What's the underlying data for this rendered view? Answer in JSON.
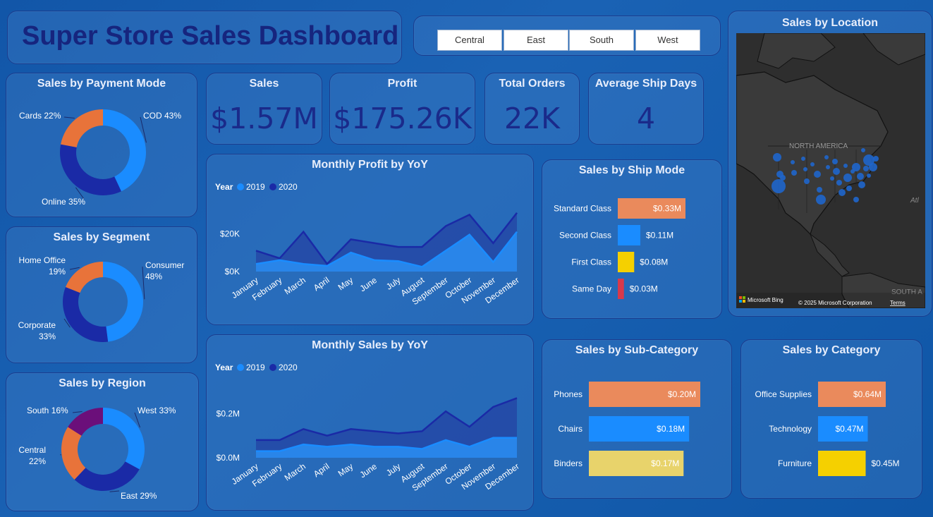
{
  "title": "Super Store Sales Dashboard",
  "slicer": {
    "options": [
      "Central",
      "East",
      "South",
      "West"
    ]
  },
  "kpis": {
    "sales": {
      "label": "Sales",
      "value": "$1.57M"
    },
    "profit": {
      "label": "Profit",
      "value": "$175.26K"
    },
    "orders": {
      "label": "Total Orders",
      "value": "22K"
    },
    "ship_days": {
      "label": "Average Ship Days",
      "value": "4"
    }
  },
  "map": {
    "title": "Sales by Location",
    "continent_label": "NORTH AMERICA",
    "south_label": "SOUTH A",
    "atl_label": "Atl",
    "bing_label": "Microsoft Bing",
    "copyright": "© 2025 Microsoft Corporation",
    "terms": "Terms"
  },
  "colors": {
    "orange": "#e8733a",
    "blue": "#1a8cff",
    "navy": "#1a2aa6",
    "purple": "#6b0f7a",
    "yellow": "#f5d000",
    "red": "#d8394b",
    "salmon": "#ea8a5c",
    "khaki": "#e8d36b",
    "series2019": "#1a8cff",
    "series2020": "#1a2aa6"
  },
  "chart_data": [
    {
      "id": "payment",
      "type": "pie",
      "title": "Sales by Payment Mode",
      "labels": [
        "COD",
        "Online",
        "Cards"
      ],
      "values": [
        43,
        35,
        22
      ],
      "label_texts": [
        "COD 43%",
        "Online 35%",
        "Cards 22%"
      ]
    },
    {
      "id": "segment",
      "type": "pie",
      "title": "Sales by Segment",
      "labels": [
        "Consumer",
        "Corporate",
        "Home Office"
      ],
      "values": [
        48,
        33,
        19
      ],
      "label_texts": [
        "Consumer\n48%",
        "Corporate\n33%",
        "Home Office\n19%"
      ]
    },
    {
      "id": "region",
      "type": "pie",
      "title": "Sales by Region",
      "labels": [
        "West",
        "East",
        "Central",
        "South"
      ],
      "values": [
        33,
        29,
        22,
        16
      ],
      "label_texts": [
        "West 33%",
        "East 29%",
        "Central\n22%",
        "South 16%"
      ]
    },
    {
      "id": "profit_yoy",
      "type": "area",
      "title": "Monthly Profit by YoY",
      "legend_title": "Year",
      "categories": [
        "January",
        "February",
        "March",
        "April",
        "May",
        "June",
        "July",
        "August",
        "September",
        "October",
        "November",
        "December"
      ],
      "series": [
        {
          "name": "2019",
          "values": [
            4000,
            6000,
            4000,
            3000,
            10000,
            6000,
            5500,
            2500,
            11000,
            19500,
            5000,
            21000
          ]
        },
        {
          "name": "2020",
          "values": [
            11000,
            7000,
            21000,
            4000,
            17000,
            15000,
            13000,
            13000,
            24000,
            30000,
            15000,
            31000
          ]
        }
      ],
      "ylim": [
        0,
        35000
      ],
      "yticks": [
        0,
        20000
      ],
      "ytick_labels": [
        "$0K",
        "$20K"
      ]
    },
    {
      "id": "sales_yoy",
      "type": "area",
      "title": "Monthly Sales by YoY",
      "legend_title": "Year",
      "categories": [
        "January",
        "February",
        "March",
        "April",
        "May",
        "June",
        "July",
        "August",
        "September",
        "October",
        "November",
        "December"
      ],
      "series": [
        {
          "name": "2019",
          "values": [
            0.03,
            0.03,
            0.06,
            0.05,
            0.06,
            0.05,
            0.05,
            0.04,
            0.08,
            0.05,
            0.09,
            0.09
          ]
        },
        {
          "name": "2020",
          "values": [
            0.08,
            0.08,
            0.13,
            0.1,
            0.13,
            0.12,
            0.11,
            0.12,
            0.21,
            0.14,
            0.23,
            0.27
          ]
        }
      ],
      "ylim": [
        0,
        0.3
      ],
      "yticks": [
        0,
        0.2
      ],
      "ytick_labels": [
        "$0.0M",
        "$0.2M"
      ]
    },
    {
      "id": "ship_mode",
      "type": "bar",
      "title": "Sales by Ship Mode",
      "categories": [
        "Standard Class",
        "Second Class",
        "First Class",
        "Same Day"
      ],
      "values": [
        0.33,
        0.11,
        0.08,
        0.03
      ],
      "value_labels": [
        "$0.33M",
        "$0.11M",
        "$0.08M",
        "$0.03M"
      ],
      "xlim": [
        0,
        0.33
      ]
    },
    {
      "id": "subcategory",
      "type": "bar",
      "title": "Sales by Sub-Category",
      "categories": [
        "Phones",
        "Chairs",
        "Binders"
      ],
      "values": [
        0.2,
        0.18,
        0.17
      ],
      "value_labels": [
        "$0.20M",
        "$0.18M",
        "$0.17M"
      ],
      "xlim": [
        0,
        0.2
      ]
    },
    {
      "id": "category",
      "type": "bar",
      "title": "Sales by Category",
      "categories": [
        "Office Supplies",
        "Technology",
        "Furniture"
      ],
      "values": [
        0.64,
        0.47,
        0.45
      ],
      "value_labels": [
        "$0.64M",
        "$0.47M",
        "$0.45M"
      ],
      "xlim": [
        0,
        0.64
      ]
    }
  ]
}
